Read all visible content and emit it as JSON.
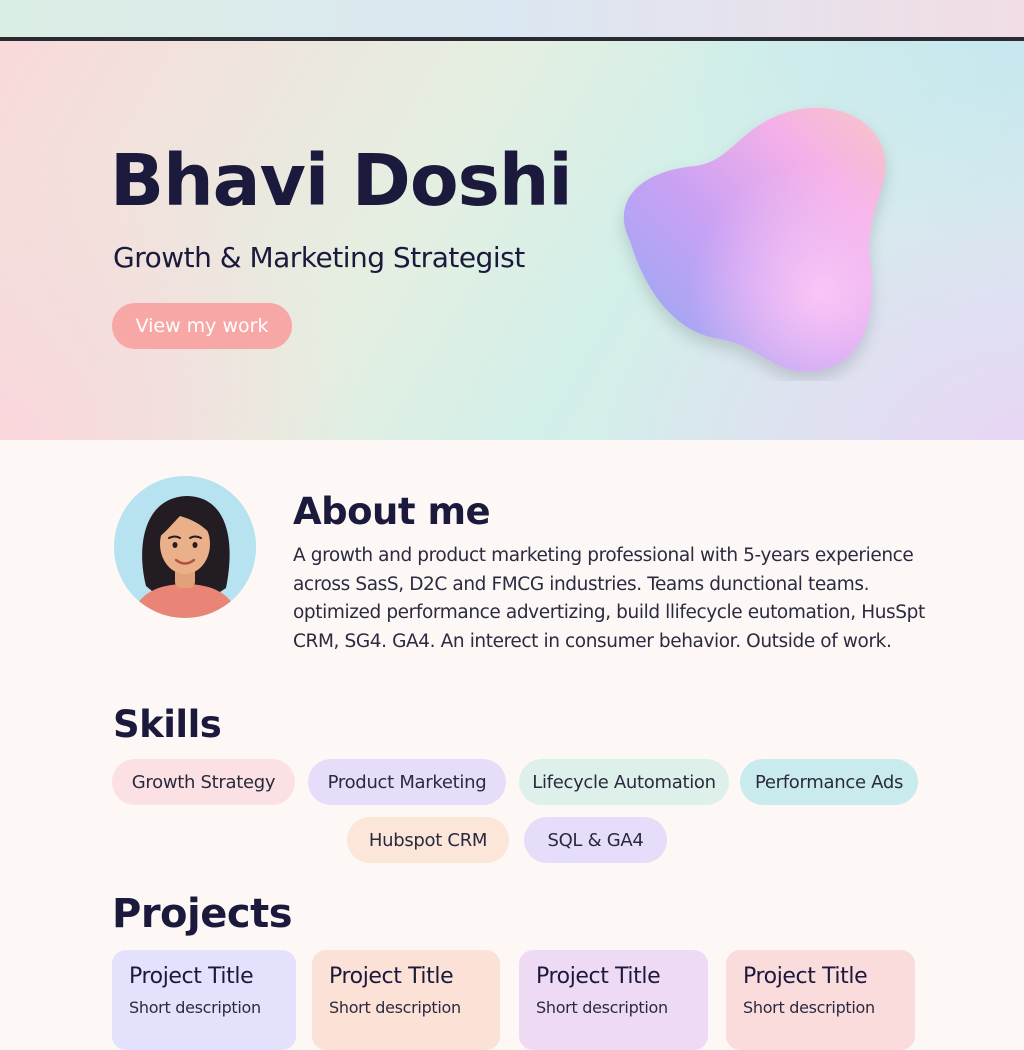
{
  "hero": {
    "name": "Bhavi Doshi",
    "subtitle": "Growth & Marketing Strategist",
    "cta_label": "View my work"
  },
  "about": {
    "title": "About me",
    "body": "A growth and product marketing professional with 5-years experience across SasS, D2C and FMCG industries. Teams dunctional teams. optimized performance advertizing, build llifecycle eutomation, HusSpt CRM, SG4. GA4. An interect in consumer behavior. Outside of work."
  },
  "skills": {
    "title": "Skills",
    "items": [
      {
        "label": "Growth Strategy",
        "color": "#fbe1e3"
      },
      {
        "label": "Product Marketing",
        "color": "#e6ddfa"
      },
      {
        "label": "Lifecycle Automation",
        "color": "#ddf1ea"
      },
      {
        "label": "Performance Ads",
        "color": "#c9ebee"
      },
      {
        "label": "Hubspot CRM",
        "color": "#fbe6d9"
      },
      {
        "label": "SQL & GA4",
        "color": "#e6ddfa"
      }
    ]
  },
  "projects": {
    "title": "Projects",
    "items": [
      {
        "title": "Project Title",
        "description": "Short description",
        "color": "#e3e1fb"
      },
      {
        "title": "Project Title",
        "description": "Short description",
        "color": "#fbe1d6"
      },
      {
        "title": "Project Title",
        "description": "Short description",
        "color": "#efdaf6"
      },
      {
        "title": "Project Title",
        "description": "Short description",
        "color": "#fbdcdc"
      }
    ]
  },
  "colors": {
    "ink": "#1b1a3d",
    "cta": "#f7a7a6",
    "avatar_bg": "#b7e2ef"
  }
}
